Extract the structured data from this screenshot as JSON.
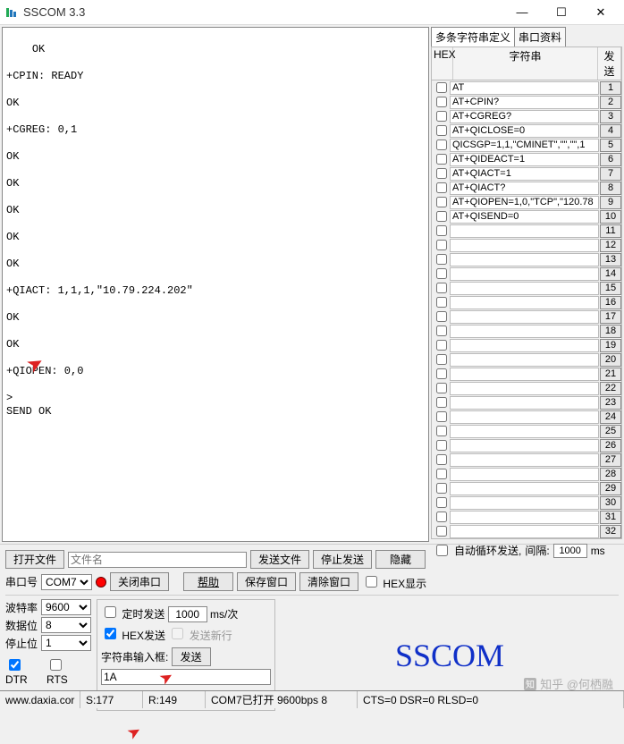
{
  "window": {
    "title": "SSCOM 3.3",
    "min": "—",
    "max": "☐",
    "close": "✕"
  },
  "console_text": "OK\n\n+CPIN: READY\n\nOK\n\n+CGREG: 0,1\n\nOK\n\nOK\n\nOK\n\nOK\n\nOK\n\n+QIACT: 1,1,1,\"10.79.224.202\"\n\nOK\n\nOK\n\n+QIOPEN: 0,0\n\n>\nSEND OK\n",
  "sidebar": {
    "tab1": "多条字符串定义",
    "tab2": "串口资料",
    "hdr_hex": "HEX",
    "hdr_str": "字符串",
    "hdr_send": "发送",
    "items": [
      "AT",
      "AT+CPIN?",
      "AT+CGREG?",
      "AT+QICLOSE=0",
      "QICSGP=1,1,\"CMINET\",\"\",\"\",1",
      "AT+QIDEACT=1",
      "AT+QIACT=1",
      "AT+QIACT?",
      "AT+QIOPEN=1,0,\"TCP\",\"120.78",
      "AT+QISEND=0",
      "",
      "",
      "",
      "",
      "",
      "",
      "",
      "",
      "",
      "",
      "",
      "",
      "",
      "",
      "",
      "",
      "",
      "",
      "",
      "",
      "",
      ""
    ],
    "autoloop_label": "自动循环发送,",
    "interval_label": "间隔:",
    "interval_value": "1000",
    "ms": "ms"
  },
  "bottom": {
    "open_file": "打开文件",
    "filename_placeholder": "文件名",
    "send_file": "发送文件",
    "stop_send": "停止发送",
    "hide": "隐藏",
    "port_label": "串口号",
    "port_value": "COM7",
    "close_port": "关闭串口",
    "help": "帮助",
    "save_win": "保存窗口",
    "clear_win": "清除窗口",
    "hex_show": "HEX显示",
    "baud_label": "波特率",
    "baud_value": "9600",
    "databits_label": "数据位",
    "databits_value": "8",
    "stopbits_label": "停止位",
    "stopbits_value": "1",
    "dtr": "DTR",
    "rts": "RTS",
    "timed_send": "定时发送",
    "timed_value": "1000",
    "timed_unit": "ms/次",
    "hex_send": "HEX发送",
    "send_newline": "发送新行",
    "input_label": "字符串输入框:",
    "send_btn": "发送",
    "input_value": "1A",
    "logo": "SSCOM"
  },
  "status": {
    "url": "www.daxia.cor",
    "s": "S:177",
    "r": "R:149",
    "info": "COM7已打开 9600bps 8",
    "signals": "CTS=0 DSR=0 RLSD=0"
  },
  "watermark": "知乎 @何栖融"
}
